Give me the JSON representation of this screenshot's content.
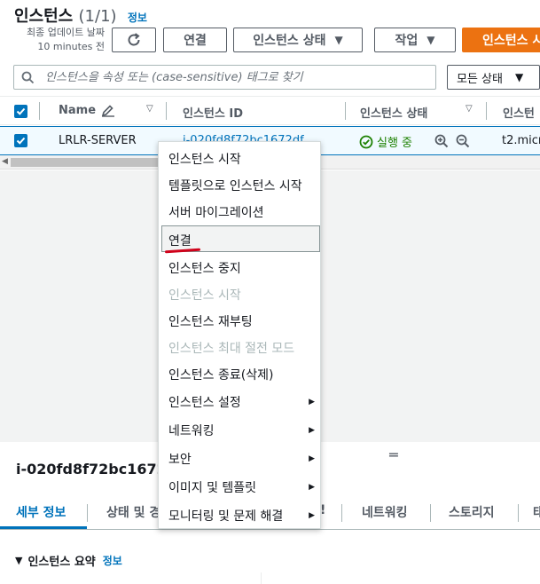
{
  "header": {
    "title": "인스턴스",
    "count": "(1/1)",
    "info": "정보",
    "last_update_label": "최종 업데이트 날짜",
    "last_update_value": "10 minutes 전"
  },
  "toolbar": {
    "connect": "연결",
    "instance_state": "인스턴스 상태",
    "actions": "작업",
    "launch": "인스턴스 시"
  },
  "search": {
    "placeholder": "인스턴스을 속성 또는 (case-sensitive) 태그로 찾기"
  },
  "state_filter": {
    "selected": "모든 상태"
  },
  "table": {
    "columns": [
      "Name",
      "인스턴스 ID",
      "인스턴스 상태",
      "인스턴"
    ],
    "rows": [
      {
        "name": "LRLR-SERVER",
        "id": "i-020fd8f72bc1672df",
        "status": "실행 중",
        "type": "t2.micr"
      }
    ]
  },
  "context_menu": {
    "items": [
      {
        "label": "인스턴스 시작",
        "disabled": false
      },
      {
        "label": "템플릿으로 인스턴스 시작",
        "disabled": false
      },
      {
        "label": "서버 마이그레이션",
        "disabled": false
      },
      {
        "label": "연결",
        "disabled": false,
        "highlighted": true
      },
      {
        "label": "인스턴스 중지",
        "disabled": false
      },
      {
        "label": "인스턴스 시작",
        "disabled": true
      },
      {
        "label": "인스턴스 재부팅",
        "disabled": false
      },
      {
        "label": "인스턴스 최대 절전 모드",
        "disabled": true
      },
      {
        "label": "인스턴스 종료(삭제)",
        "disabled": false
      },
      {
        "label": "인스턴스 설정",
        "submenu": true
      },
      {
        "label": "네트워킹",
        "submenu": true
      },
      {
        "label": "보안",
        "submenu": true
      },
      {
        "label": "이미지 및 템플릿",
        "submenu": true
      },
      {
        "label": "모니터링 및 문제 해결",
        "submenu": true
      }
    ]
  },
  "detail": {
    "title": "i-020fd8f72bc1672",
    "tabs": [
      "세부 정보",
      "상태 및 경",
      "네트워킹",
      "스토리지",
      "태"
    ],
    "tab_partial": "!",
    "summary": "인스턴스 요약",
    "summary_info": "정보"
  },
  "colors": {
    "accent": "#0073bb",
    "primary": "#ec7211",
    "success": "#1d8102",
    "annotation": "#d0021b"
  }
}
